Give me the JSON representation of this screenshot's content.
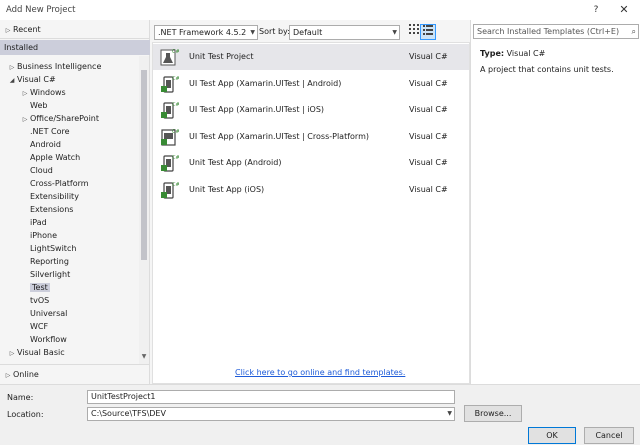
{
  "window": {
    "title": "Add New Project",
    "help": "?",
    "close": "✕"
  },
  "tree": {
    "recent": "Recent",
    "installed": "Installed",
    "online": "Online",
    "items": [
      {
        "label": "Business Intelligence",
        "level": 1,
        "expander": "▷"
      },
      {
        "label": "Visual C#",
        "level": 1,
        "expander": "◢"
      },
      {
        "label": "Windows",
        "level": 2,
        "expander": "▷"
      },
      {
        "label": "Web",
        "level": 2,
        "expander": ""
      },
      {
        "label": "Office/SharePoint",
        "level": 2,
        "expander": "▷"
      },
      {
        "label": ".NET Core",
        "level": 2,
        "expander": ""
      },
      {
        "label": "Android",
        "level": 2,
        "expander": ""
      },
      {
        "label": "Apple Watch",
        "level": 2,
        "expander": ""
      },
      {
        "label": "Cloud",
        "level": 2,
        "expander": ""
      },
      {
        "label": "Cross-Platform",
        "level": 2,
        "expander": ""
      },
      {
        "label": "Extensibility",
        "level": 2,
        "expander": ""
      },
      {
        "label": "Extensions",
        "level": 2,
        "expander": ""
      },
      {
        "label": "iPad",
        "level": 2,
        "expander": ""
      },
      {
        "label": "iPhone",
        "level": 2,
        "expander": ""
      },
      {
        "label": "LightSwitch",
        "level": 2,
        "expander": ""
      },
      {
        "label": "Reporting",
        "level": 2,
        "expander": ""
      },
      {
        "label": "Silverlight",
        "level": 2,
        "expander": ""
      },
      {
        "label": "Test",
        "level": 2,
        "expander": "",
        "selected": true
      },
      {
        "label": "tvOS",
        "level": 2,
        "expander": ""
      },
      {
        "label": "Universal",
        "level": 2,
        "expander": ""
      },
      {
        "label": "WCF",
        "level": 2,
        "expander": ""
      },
      {
        "label": "Workflow",
        "level": 2,
        "expander": ""
      },
      {
        "label": "Visual Basic",
        "level": 1,
        "expander": "▷"
      }
    ]
  },
  "toolbar": {
    "framework": ".NET Framework 4.5.2",
    "sort_label": "Sort by:",
    "sort_value": "Default"
  },
  "templates": [
    {
      "name": "Unit Test Project",
      "lang": "Visual C#",
      "icon": "unit-test-flask-icon",
      "selected": true
    },
    {
      "name": "UI Test App (Xamarin.UITest | Android)",
      "lang": "Visual C#",
      "icon": "phone-test-icon"
    },
    {
      "name": "UI Test App (Xamarin.UITest | iOS)",
      "lang": "Visual C#",
      "icon": "phone-test-icon"
    },
    {
      "name": "UI Test App (Xamarin.UITest | Cross-Platform)",
      "lang": "Visual C#",
      "icon": "cross-platform-test-icon"
    },
    {
      "name": "Unit Test App (Android)",
      "lang": "Visual C#",
      "icon": "phone-test-icon"
    },
    {
      "name": "Unit Test App (iOS)",
      "lang": "Visual C#",
      "icon": "phone-test-icon"
    }
  ],
  "online_link": "Click here to go online and find templates.",
  "details": {
    "search_placeholder": "Search Installed Templates (Ctrl+E)",
    "type_label": "Type:",
    "type_value": "Visual C#",
    "description": "A project that contains unit tests."
  },
  "form": {
    "name_label": "Name:",
    "name_value": "UnitTestProject1",
    "location_label": "Location:",
    "location_value": "C:\\Source\\TFS\\DEV",
    "browse": "Browse...",
    "ok": "OK",
    "cancel": "Cancel"
  },
  "colors": {
    "selection": "#cccedb",
    "link": "#1e5bd8",
    "accent": "#3399ff",
    "csharp_green": "#388a34"
  }
}
